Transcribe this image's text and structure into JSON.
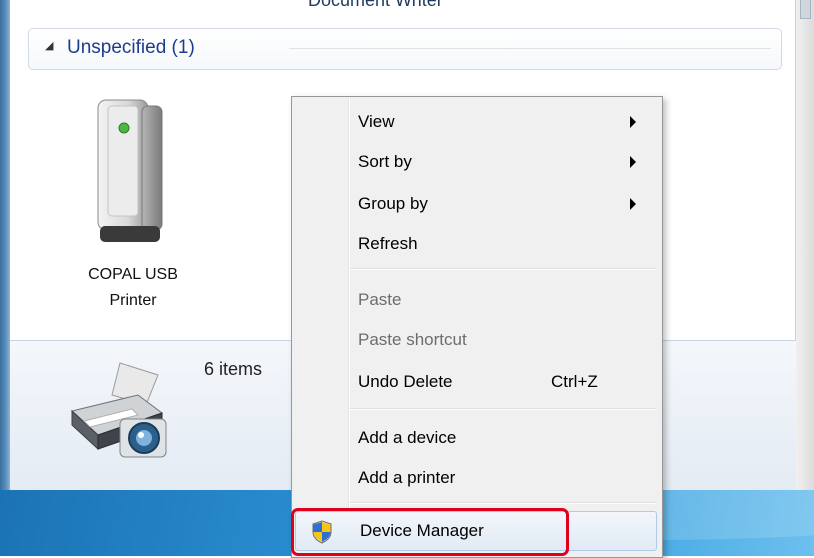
{
  "window": {
    "cutoff_label": "Document Writer",
    "group": {
      "arrow": "◢",
      "title": "Unspecified (1)"
    },
    "device": {
      "icon": "usb-printer-icon",
      "label_line1": "COPAL USB",
      "label_line2": "Printer"
    },
    "details": {
      "icon": "printer-camera-icon",
      "count": "6 items"
    }
  },
  "context_menu": {
    "items": [
      {
        "label": "View",
        "submenu": true
      },
      {
        "label": "Sort by",
        "submenu": true
      },
      {
        "label": "Group by",
        "submenu": true
      },
      {
        "label": "Refresh"
      },
      {
        "label": "Paste",
        "disabled": true
      },
      {
        "label": "Paste shortcut",
        "disabled": true
      },
      {
        "label": "Undo Delete",
        "shortcut": "Ctrl+Z"
      },
      {
        "label": "Add a device"
      },
      {
        "label": "Add a printer"
      },
      {
        "label": "Device Manager",
        "icon": "uac-shield-icon",
        "highlighted": true
      }
    ]
  },
  "colors": {
    "highlight_box": "#e0001b",
    "group_title": "#1e3c8c",
    "taskbar": "#2a8ed0"
  }
}
